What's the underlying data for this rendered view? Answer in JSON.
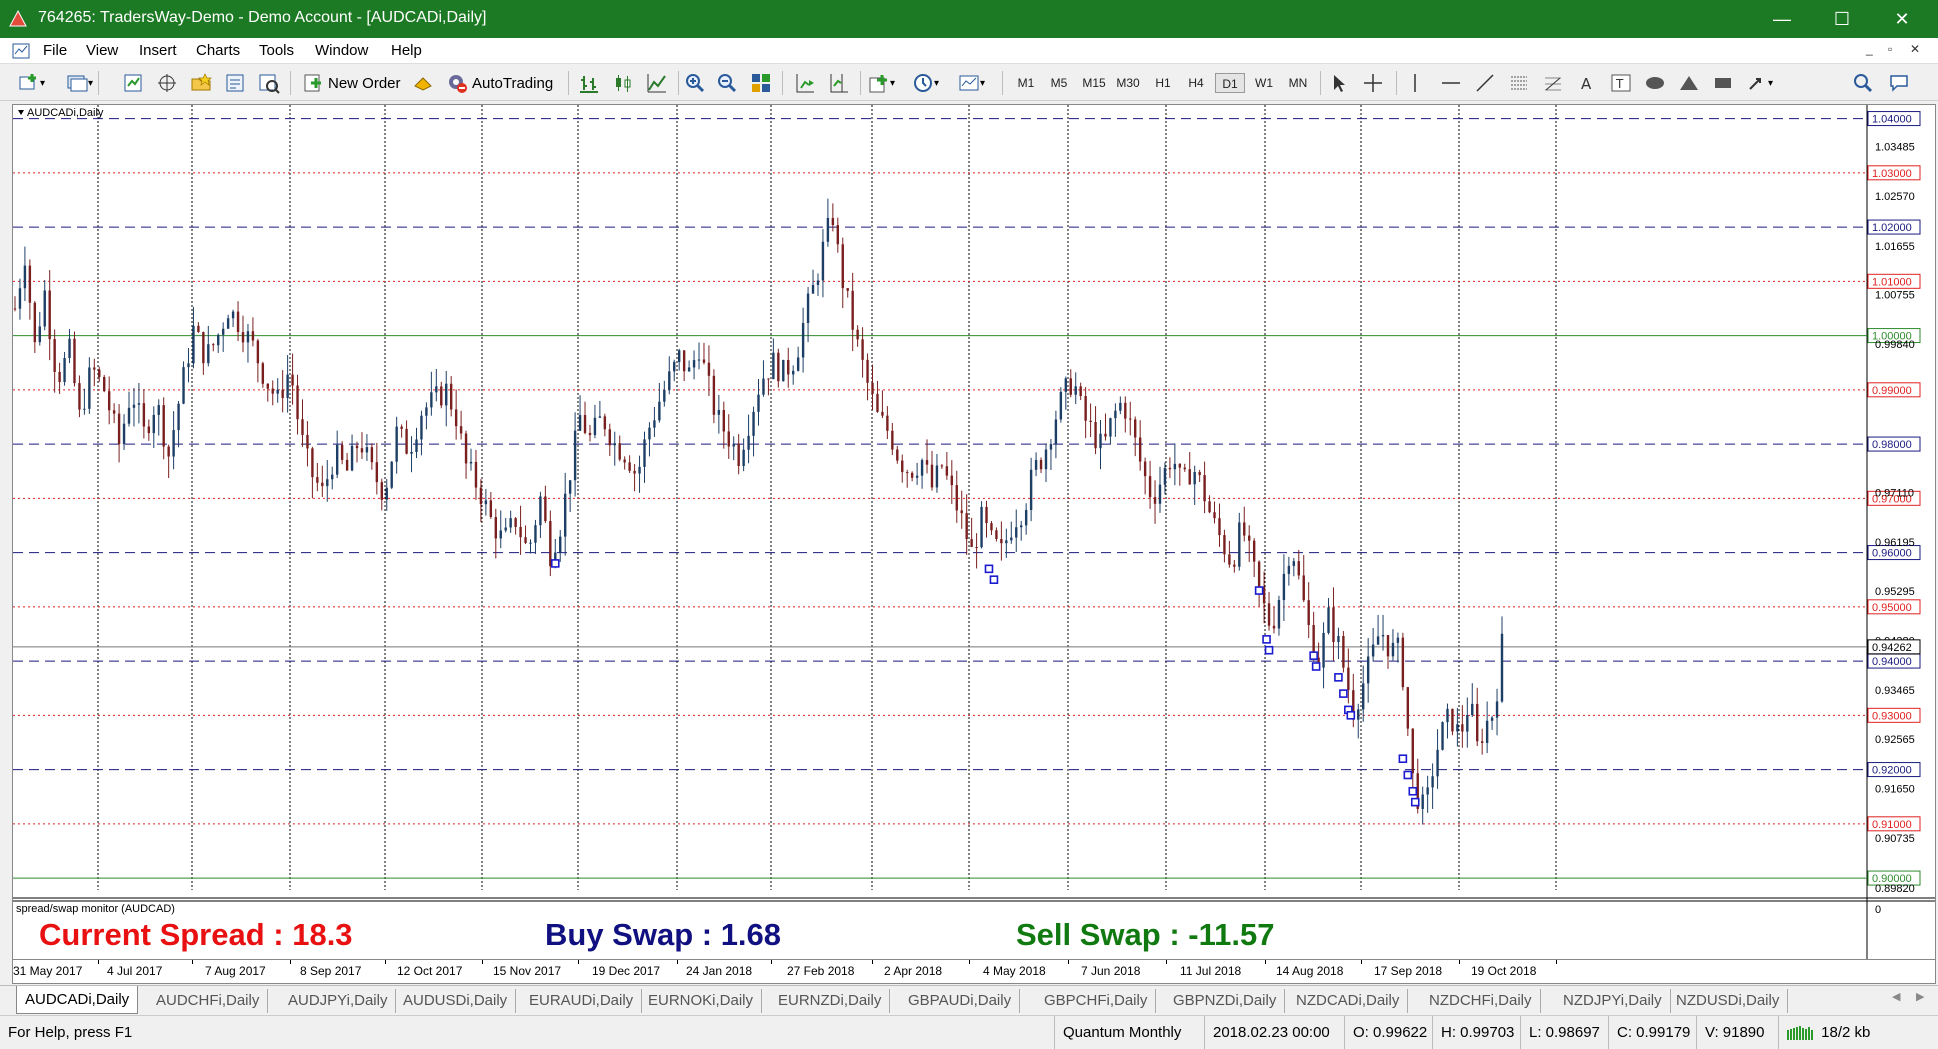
{
  "window": {
    "title": "764265: TradersWay-Demo - Demo Account - [AUDCADi,Daily]",
    "minimize": "—",
    "maximize": "☐",
    "close": "✕",
    "icon": "metatrader-icon"
  },
  "menu": {
    "items": [
      "File",
      "View",
      "Insert",
      "Charts",
      "Tools",
      "Window",
      "Help"
    ],
    "mdi_minimize": "_",
    "mdi_restore": "▫",
    "mdi_close": "✕"
  },
  "toolbar": {
    "new_order": "New Order",
    "autotrading": "AutoTrading",
    "timeframes": [
      "M1",
      "M5",
      "M15",
      "M30",
      "H1",
      "H4",
      "D1",
      "W1",
      "MN"
    ],
    "active_timeframe": "D1"
  },
  "chart": {
    "label": "AUDCADi,Daily",
    "price_top": 1.0425,
    "price_bottom": 0.8978,
    "price_labels": [
      "1.03485",
      "1.02570",
      "1.01655",
      "1.00755",
      "0.99840",
      "0.97110",
      "0.96195",
      "0.95295",
      "0.94380",
      "0.93465",
      "0.92565",
      "0.91650",
      "0.90735",
      "0.89820"
    ],
    "price_label_values": [
      1.03485,
      1.0257,
      1.01655,
      1.00755,
      0.9984,
      0.9711,
      0.96195,
      0.95295,
      0.9438,
      0.93465,
      0.92565,
      0.9165,
      0.90735,
      0.8982
    ],
    "date_labels": [
      "31 May 2017",
      "4 Jul 2017",
      "7 Aug 2017",
      "8 Sep 2017",
      "12 Oct 2017",
      "15 Nov 2017",
      "19 Dec 2017",
      "24 Jan 2018",
      "27 Feb 2018",
      "2 Apr 2018",
      "4 May 2018",
      "7 Jun 2018",
      "11 Jul 2018",
      "14 Aug 2018",
      "17 Sep 2018",
      "19 Oct 2018"
    ],
    "current_price": "0.94262",
    "current_price_value": 0.94262,
    "levels": [
      {
        "text": "1.04000",
        "value": 1.04,
        "kind": "blue"
      },
      {
        "text": "1.03000",
        "value": 1.03,
        "kind": "red"
      },
      {
        "text": "1.02000",
        "value": 1.02,
        "kind": "blue"
      },
      {
        "text": "1.01000",
        "value": 1.01,
        "kind": "red"
      },
      {
        "text": "1.00000",
        "value": 1.0,
        "kind": "green"
      },
      {
        "text": "0.99000",
        "value": 0.99,
        "kind": "red"
      },
      {
        "text": "0.98000",
        "value": 0.98,
        "kind": "blue"
      },
      {
        "text": "0.97000",
        "value": 0.97,
        "kind": "red"
      },
      {
        "text": "0.96000",
        "value": 0.96,
        "kind": "blue"
      },
      {
        "text": "0.95000",
        "value": 0.95,
        "kind": "red"
      },
      {
        "text": "0.94000",
        "value": 0.94,
        "kind": "blue"
      },
      {
        "text": "0.93000",
        "value": 0.93,
        "kind": "red"
      },
      {
        "text": "0.92000",
        "value": 0.92,
        "kind": "blue"
      },
      {
        "text": "0.91000",
        "value": 0.91,
        "kind": "red"
      },
      {
        "text": "0.90000",
        "value": 0.9,
        "kind": "green"
      }
    ],
    "colors": {
      "blue": "#1a1a80",
      "red": "#e02020",
      "green": "#2e8b2e",
      "candle_up": "#1d3f66",
      "candle_down": "#7a1f1f",
      "marker": "#1a1ad0"
    },
    "close_path": [
      [
        0,
        1.005
      ],
      [
        8,
        1.015
      ],
      [
        16,
        0.998
      ],
      [
        24,
        1.008
      ],
      [
        34,
        0.992
      ],
      [
        44,
        0.997
      ],
      [
        52,
        0.985
      ],
      [
        62,
        0.994
      ],
      [
        72,
        0.99
      ],
      [
        84,
        0.98
      ],
      [
        94,
        0.99
      ],
      [
        104,
        0.982
      ],
      [
        114,
        0.988
      ],
      [
        124,
        0.978
      ],
      [
        134,
        0.99
      ],
      [
        144,
        1.001
      ],
      [
        154,
        0.996
      ],
      [
        162,
        0.999
      ],
      [
        172,
        1.005
      ],
      [
        182,
        1.002
      ],
      [
        192,
        0.998
      ],
      [
        202,
        0.992
      ],
      [
        212,
        0.988
      ],
      [
        222,
        0.994
      ],
      [
        230,
        0.982
      ],
      [
        238,
        0.975
      ],
      [
        248,
        0.971
      ],
      [
        258,
        0.978
      ],
      [
        268,
        0.975
      ],
      [
        278,
        0.981
      ],
      [
        288,
        0.975
      ],
      [
        298,
        0.971
      ],
      [
        308,
        0.982
      ],
      [
        318,
        0.979
      ],
      [
        328,
        0.986
      ],
      [
        338,
        0.988
      ],
      [
        348,
        0.99
      ],
      [
        356,
        0.985
      ],
      [
        364,
        0.976
      ],
      [
        374,
        0.972
      ],
      [
        384,
        0.966
      ],
      [
        394,
        0.962
      ],
      [
        404,
        0.966
      ],
      [
        414,
        0.96
      ],
      [
        424,
        0.97
      ],
      [
        432,
        0.96
      ],
      [
        440,
        0.965
      ],
      [
        448,
        0.975
      ],
      [
        456,
        0.985
      ],
      [
        464,
        0.981
      ],
      [
        474,
        0.985
      ],
      [
        484,
        0.98
      ],
      [
        494,
        0.978
      ],
      [
        502,
        0.974
      ],
      [
        510,
        0.982
      ],
      [
        520,
        0.988
      ],
      [
        528,
        0.992
      ],
      [
        536,
        0.996
      ],
      [
        544,
        0.993
      ],
      [
        552,
        0.998
      ],
      [
        558,
        0.992
      ],
      [
        566,
        0.985
      ],
      [
        574,
        0.982
      ],
      [
        584,
        0.978
      ],
      [
        592,
        0.984
      ],
      [
        602,
        0.992
      ],
      [
        612,
        0.995
      ],
      [
        620,
        0.993
      ],
      [
        630,
        0.996
      ],
      [
        638,
        1.004
      ],
      [
        646,
        1.01
      ],
      [
        654,
        1.018
      ],
      [
        660,
        1.022
      ],
      [
        666,
        1.012
      ],
      [
        672,
        1.006
      ],
      [
        680,
        0.998
      ],
      [
        688,
        0.991
      ],
      [
        696,
        0.985
      ],
      [
        706,
        0.982
      ],
      [
        714,
        0.977
      ],
      [
        722,
        0.975
      ],
      [
        732,
        0.977
      ],
      [
        740,
        0.972
      ],
      [
        748,
        0.976
      ],
      [
        756,
        0.971
      ],
      [
        764,
        0.966
      ],
      [
        772,
        0.96
      ],
      [
        780,
        0.966
      ],
      [
        788,
        0.962
      ],
      [
        796,
        0.96
      ],
      [
        806,
        0.966
      ],
      [
        814,
        0.968
      ],
      [
        822,
        0.975
      ],
      [
        830,
        0.978
      ],
      [
        838,
        0.984
      ],
      [
        846,
        0.989
      ],
      [
        854,
        0.992
      ],
      [
        862,
        0.985
      ],
      [
        870,
        0.982
      ],
      [
        878,
        0.979
      ],
      [
        886,
        0.985
      ],
      [
        894,
        0.988
      ],
      [
        902,
        0.982
      ],
      [
        910,
        0.975
      ],
      [
        918,
        0.97
      ],
      [
        926,
        0.974
      ],
      [
        934,
        0.978
      ],
      [
        942,
        0.972
      ],
      [
        950,
        0.976
      ],
      [
        958,
        0.972
      ],
      [
        966,
        0.966
      ],
      [
        974,
        0.962
      ],
      [
        982,
        0.958
      ],
      [
        990,
        0.965
      ],
      [
        998,
        0.958
      ],
      [
        1006,
        0.951
      ],
      [
        1014,
        0.946
      ],
      [
        1022,
        0.954
      ],
      [
        1030,
        0.962
      ],
      [
        1036,
        0.955
      ],
      [
        1044,
        0.946
      ],
      [
        1052,
        0.94
      ],
      [
        1060,
        0.948
      ],
      [
        1068,
        0.943
      ],
      [
        1074,
        0.937
      ],
      [
        1080,
        0.931
      ],
      [
        1088,
        0.936
      ],
      [
        1094,
        0.94
      ],
      [
        1102,
        0.946
      ],
      [
        1110,
        0.942
      ],
      [
        1116,
        0.942
      ],
      [
        1122,
        0.935
      ],
      [
        1126,
        0.92
      ],
      [
        1132,
        0.915
      ],
      [
        1138,
        0.912
      ],
      [
        1144,
        0.92
      ],
      [
        1150,
        0.926
      ],
      [
        1158,
        0.93
      ],
      [
        1166,
        0.926
      ],
      [
        1174,
        0.933
      ],
      [
        1180,
        0.924
      ],
      [
        1186,
        0.928
      ],
      [
        1194,
        0.931
      ],
      [
        1200,
        0.943
      ]
    ],
    "markers": [
      [
        436,
        0.958
      ],
      [
        786,
        0.957
      ],
      [
        790,
        0.955
      ],
      [
        1004,
        0.953
      ],
      [
        1010,
        0.944
      ],
      [
        1012,
        0.942
      ],
      [
        1048,
        0.941
      ],
      [
        1050,
        0.939
      ],
      [
        1068,
        0.937
      ],
      [
        1072,
        0.934
      ],
      [
        1076,
        0.931
      ],
      [
        1078,
        0.93
      ],
      [
        1120,
        0.922
      ],
      [
        1124,
        0.919
      ],
      [
        1128,
        0.916
      ],
      [
        1130,
        0.914
      ]
    ]
  },
  "indicator": {
    "label": "spread/swap monitor (AUDCAD)",
    "current_spread": "Current Spread : 18.3",
    "buy_swap": "Buy Swap : 1.68",
    "sell_swap": "Sell Swap : -11.57",
    "axis_top": "0",
    "axis_bottom": "0",
    "colors": {
      "spread": "#e81010",
      "buy": "#101080",
      "sell": "#107a10"
    }
  },
  "tabs": [
    "AUDCADi,Daily",
    "AUDCHFi,Daily",
    "AUDJPYi,Daily",
    "AUDUSDi,Daily",
    "EURAUDi,Daily",
    "EURNOKi,Daily",
    "EURNZDi,Daily",
    "GBPAUDi,Daily",
    "GBPCHFi,Daily",
    "GBPNZDi,Daily",
    "NZDCADi,Daily",
    "NZDCHFi,Daily",
    "NZDJPYi,Daily",
    "NZDUSDi,Daily"
  ],
  "status": {
    "help": "For Help, press F1",
    "profile": "Quantum Monthly",
    "time": "2018.02.23 00:00",
    "open": "O: 0.99622",
    "high": "H: 0.99703",
    "low": "L: 0.98697",
    "close": "C: 0.99179",
    "volume": "V: 91890",
    "traffic": "18/2 kb"
  }
}
